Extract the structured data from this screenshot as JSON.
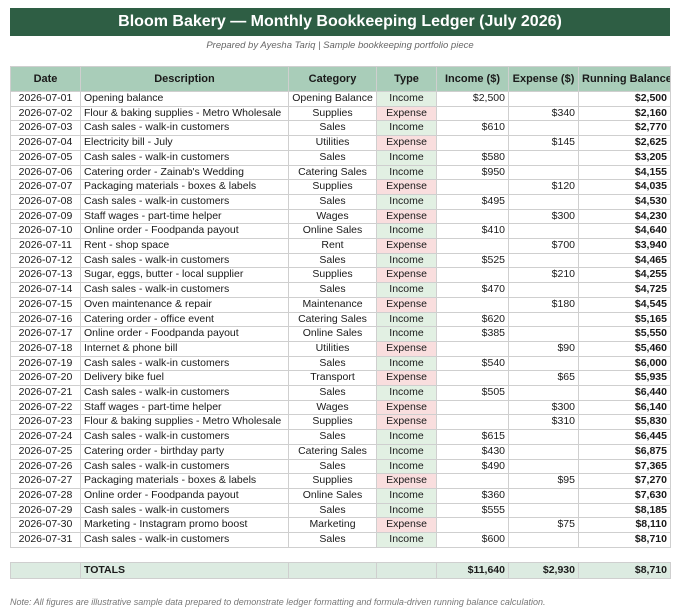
{
  "title": "Bloom Bakery — Monthly Bookkeeping Ledger (July 2026)",
  "subtitle": "Prepared by Ayesha Tariq | Sample bookkeeping portfolio piece",
  "colors": {
    "header_bar": "#2e5e44",
    "column_header": "#a9cdb9",
    "income_cell": "#e2f0e3",
    "expense_cell": "#f9dede",
    "totals_row": "#dcebe1"
  },
  "columns": [
    "Date",
    "Description",
    "Category",
    "Type",
    "Income ($)",
    "Expense ($)",
    "Running Balance ($)"
  ],
  "rows": [
    [
      "2026-07-01",
      "Opening balance",
      "Opening Balance",
      "Income",
      "$2,500",
      "",
      "$2,500"
    ],
    [
      "2026-07-02",
      "Flour & baking supplies - Metro Wholesale",
      "Supplies",
      "Expense",
      "",
      "$340",
      "$2,160"
    ],
    [
      "2026-07-03",
      "Cash sales - walk-in customers",
      "Sales",
      "Income",
      "$610",
      "",
      "$2,770"
    ],
    [
      "2026-07-04",
      "Electricity bill - July",
      "Utilities",
      "Expense",
      "",
      "$145",
      "$2,625"
    ],
    [
      "2026-07-05",
      "Cash sales - walk-in customers",
      "Sales",
      "Income",
      "$580",
      "",
      "$3,205"
    ],
    [
      "2026-07-06",
      "Catering order - Zainab's Wedding",
      "Catering Sales",
      "Income",
      "$950",
      "",
      "$4,155"
    ],
    [
      "2026-07-07",
      "Packaging materials - boxes & labels",
      "Supplies",
      "Expense",
      "",
      "$120",
      "$4,035"
    ],
    [
      "2026-07-08",
      "Cash sales - walk-in customers",
      "Sales",
      "Income",
      "$495",
      "",
      "$4,530"
    ],
    [
      "2026-07-09",
      "Staff wages - part-time helper",
      "Wages",
      "Expense",
      "",
      "$300",
      "$4,230"
    ],
    [
      "2026-07-10",
      "Online order - Foodpanda payout",
      "Online Sales",
      "Income",
      "$410",
      "",
      "$4,640"
    ],
    [
      "2026-07-11",
      "Rent - shop space",
      "Rent",
      "Expense",
      "",
      "$700",
      "$3,940"
    ],
    [
      "2026-07-12",
      "Cash sales - walk-in customers",
      "Sales",
      "Income",
      "$525",
      "",
      "$4,465"
    ],
    [
      "2026-07-13",
      "Sugar, eggs, butter - local supplier",
      "Supplies",
      "Expense",
      "",
      "$210",
      "$4,255"
    ],
    [
      "2026-07-14",
      "Cash sales - walk-in customers",
      "Sales",
      "Income",
      "$470",
      "",
      "$4,725"
    ],
    [
      "2026-07-15",
      "Oven maintenance & repair",
      "Maintenance",
      "Expense",
      "",
      "$180",
      "$4,545"
    ],
    [
      "2026-07-16",
      "Catering order - office event",
      "Catering Sales",
      "Income",
      "$620",
      "",
      "$5,165"
    ],
    [
      "2026-07-17",
      "Online order - Foodpanda payout",
      "Online Sales",
      "Income",
      "$385",
      "",
      "$5,550"
    ],
    [
      "2026-07-18",
      "Internet & phone bill",
      "Utilities",
      "Expense",
      "",
      "$90",
      "$5,460"
    ],
    [
      "2026-07-19",
      "Cash sales - walk-in customers",
      "Sales",
      "Income",
      "$540",
      "",
      "$6,000"
    ],
    [
      "2026-07-20",
      "Delivery bike fuel",
      "Transport",
      "Expense",
      "",
      "$65",
      "$5,935"
    ],
    [
      "2026-07-21",
      "Cash sales - walk-in customers",
      "Sales",
      "Income",
      "$505",
      "",
      "$6,440"
    ],
    [
      "2026-07-22",
      "Staff wages - part-time helper",
      "Wages",
      "Expense",
      "",
      "$300",
      "$6,140"
    ],
    [
      "2026-07-23",
      "Flour & baking supplies - Metro Wholesale",
      "Supplies",
      "Expense",
      "",
      "$310",
      "$5,830"
    ],
    [
      "2026-07-24",
      "Cash sales - walk-in customers",
      "Sales",
      "Income",
      "$615",
      "",
      "$6,445"
    ],
    [
      "2026-07-25",
      "Catering order - birthday party",
      "Catering Sales",
      "Income",
      "$430",
      "",
      "$6,875"
    ],
    [
      "2026-07-26",
      "Cash sales - walk-in customers",
      "Sales",
      "Income",
      "$490",
      "",
      "$7,365"
    ],
    [
      "2026-07-27",
      "Packaging materials - boxes & labels",
      "Supplies",
      "Expense",
      "",
      "$95",
      "$7,270"
    ],
    [
      "2026-07-28",
      "Online order - Foodpanda payout",
      "Online Sales",
      "Income",
      "$360",
      "",
      "$7,630"
    ],
    [
      "2026-07-29",
      "Cash sales - walk-in customers",
      "Sales",
      "Income",
      "$555",
      "",
      "$8,185"
    ],
    [
      "2026-07-30",
      "Marketing - Instagram promo boost",
      "Marketing",
      "Expense",
      "",
      "$75",
      "$8,110"
    ],
    [
      "2026-07-31",
      "Cash sales - walk-in customers",
      "Sales",
      "Income",
      "$600",
      "",
      "$8,710"
    ]
  ],
  "totals": {
    "label": "TOTALS",
    "income": "$11,640",
    "expense": "$2,930",
    "balance": "$8,710"
  },
  "note": "Note: All figures are illustrative sample data prepared to demonstrate ledger formatting and formula-driven running balance calculation."
}
